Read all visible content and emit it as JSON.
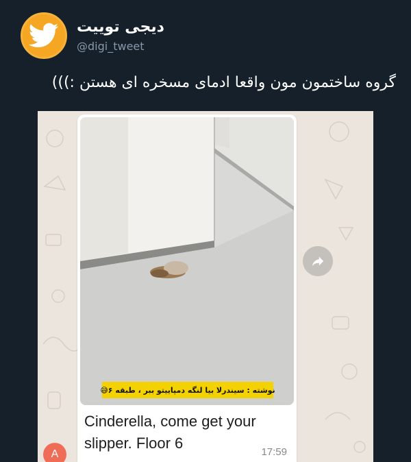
{
  "profile": {
    "display_name": "دیجی توییت",
    "handle": "@digi_tweet",
    "avatar_icon": "twitter-bird-icon",
    "avatar_color": "#f5a623"
  },
  "tweet": {
    "text": "گروه ساختمون مون واقعا ادمای مسخره ای هستن :)))"
  },
  "chat": {
    "caption": "نوشته : سیندرلا بیا لنگه دمپاییتو ببر ، طبقه ۶😅",
    "message": "Cinderella, come get your slipper. Floor 6",
    "time": "17:59",
    "sender_initial": "A",
    "forward_icon": "forward-arrow-icon",
    "background_color": "#ece5dd",
    "caption_highlight": "#f4d100"
  }
}
